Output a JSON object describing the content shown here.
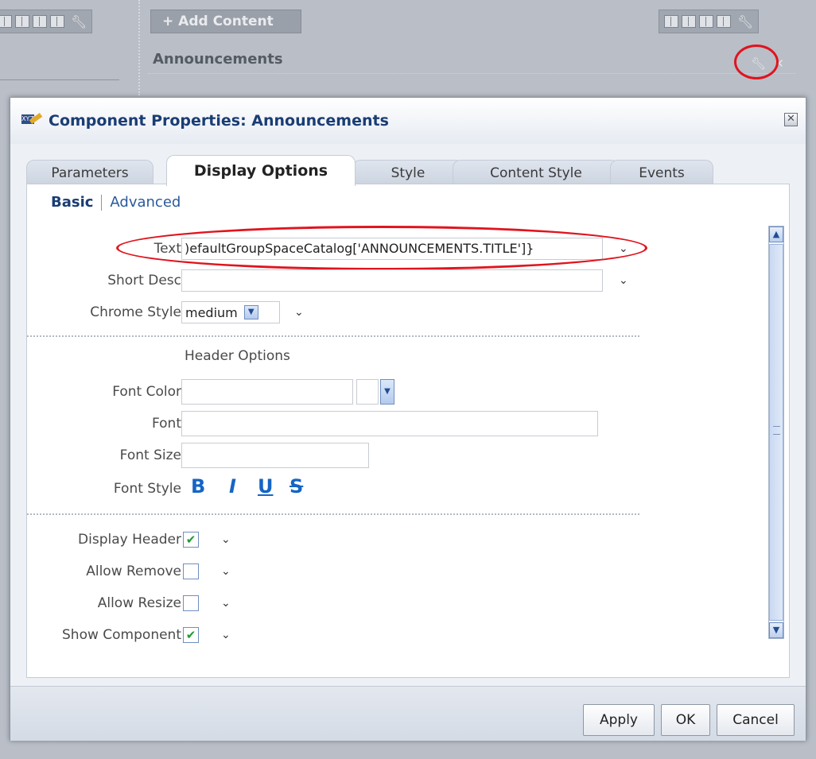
{
  "background": {
    "add_content_label": "+ Add Content",
    "panel_title": "Announcements",
    "wrench_icon": "wrench-icon",
    "close_icon": "close-icon"
  },
  "dialog": {
    "title": "Component Properties: Announcements",
    "close_glyph": "✕",
    "tabs": [
      {
        "label": "Parameters"
      },
      {
        "label": "Display Options",
        "active": true
      },
      {
        "label": "Style"
      },
      {
        "label": "Content Style"
      },
      {
        "label": "Events"
      }
    ],
    "subtabs": {
      "basic": "Basic",
      "advanced": "Advanced"
    },
    "fields": {
      "text_label": "Text",
      "text_value": ")efaultGroupSpaceCatalog['ANNOUNCEMENTS.TITLE']}",
      "short_desc_label": "Short Desc",
      "short_desc_value": "",
      "chrome_style_label": "Chrome Style",
      "chrome_style_value": "medium",
      "header_options_label": "Header Options",
      "font_color_label": "Font Color",
      "font_color_value": "",
      "font_label": "Font",
      "font_value": "",
      "font_size_label": "Font Size",
      "font_size_value": "",
      "font_style_label": "Font Style",
      "font_style_buttons": [
        "B",
        "I",
        "U",
        "S"
      ],
      "display_header_label": "Display Header",
      "display_header_checked": true,
      "allow_remove_label": "Allow Remove",
      "allow_remove_checked": false,
      "allow_resize_label": "Allow Resize",
      "allow_resize_checked": false,
      "show_component_label": "Show Component",
      "show_component_checked": true
    },
    "buttons": {
      "apply": "Apply",
      "ok": "OK",
      "cancel": "Cancel"
    },
    "check_glyph": "✔",
    "dropdown_glyph": "⌄"
  }
}
